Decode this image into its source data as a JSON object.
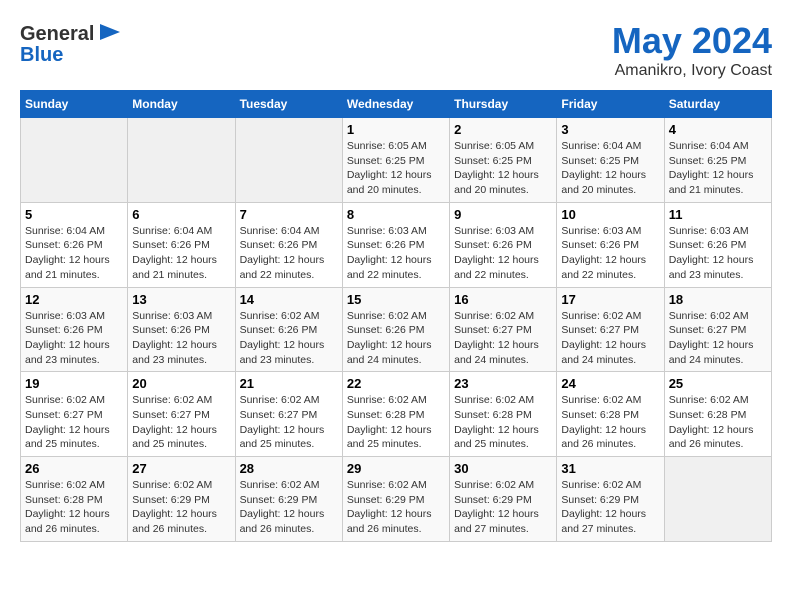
{
  "logo": {
    "general": "General",
    "blue": "Blue"
  },
  "title": "May 2024",
  "subtitle": "Amanikro, Ivory Coast",
  "days_header": [
    "Sunday",
    "Monday",
    "Tuesday",
    "Wednesday",
    "Thursday",
    "Friday",
    "Saturday"
  ],
  "weeks": [
    [
      {
        "day": "",
        "sunrise": "",
        "sunset": "",
        "daylight": ""
      },
      {
        "day": "",
        "sunrise": "",
        "sunset": "",
        "daylight": ""
      },
      {
        "day": "",
        "sunrise": "",
        "sunset": "",
        "daylight": ""
      },
      {
        "day": "1",
        "sunrise": "Sunrise: 6:05 AM",
        "sunset": "Sunset: 6:25 PM",
        "daylight": "Daylight: 12 hours and 20 minutes."
      },
      {
        "day": "2",
        "sunrise": "Sunrise: 6:05 AM",
        "sunset": "Sunset: 6:25 PM",
        "daylight": "Daylight: 12 hours and 20 minutes."
      },
      {
        "day": "3",
        "sunrise": "Sunrise: 6:04 AM",
        "sunset": "Sunset: 6:25 PM",
        "daylight": "Daylight: 12 hours and 20 minutes."
      },
      {
        "day": "4",
        "sunrise": "Sunrise: 6:04 AM",
        "sunset": "Sunset: 6:25 PM",
        "daylight": "Daylight: 12 hours and 21 minutes."
      }
    ],
    [
      {
        "day": "5",
        "sunrise": "Sunrise: 6:04 AM",
        "sunset": "Sunset: 6:26 PM",
        "daylight": "Daylight: 12 hours and 21 minutes."
      },
      {
        "day": "6",
        "sunrise": "Sunrise: 6:04 AM",
        "sunset": "Sunset: 6:26 PM",
        "daylight": "Daylight: 12 hours and 21 minutes."
      },
      {
        "day": "7",
        "sunrise": "Sunrise: 6:04 AM",
        "sunset": "Sunset: 6:26 PM",
        "daylight": "Daylight: 12 hours and 22 minutes."
      },
      {
        "day": "8",
        "sunrise": "Sunrise: 6:03 AM",
        "sunset": "Sunset: 6:26 PM",
        "daylight": "Daylight: 12 hours and 22 minutes."
      },
      {
        "day": "9",
        "sunrise": "Sunrise: 6:03 AM",
        "sunset": "Sunset: 6:26 PM",
        "daylight": "Daylight: 12 hours and 22 minutes."
      },
      {
        "day": "10",
        "sunrise": "Sunrise: 6:03 AM",
        "sunset": "Sunset: 6:26 PM",
        "daylight": "Daylight: 12 hours and 22 minutes."
      },
      {
        "day": "11",
        "sunrise": "Sunrise: 6:03 AM",
        "sunset": "Sunset: 6:26 PM",
        "daylight": "Daylight: 12 hours and 23 minutes."
      }
    ],
    [
      {
        "day": "12",
        "sunrise": "Sunrise: 6:03 AM",
        "sunset": "Sunset: 6:26 PM",
        "daylight": "Daylight: 12 hours and 23 minutes."
      },
      {
        "day": "13",
        "sunrise": "Sunrise: 6:03 AM",
        "sunset": "Sunset: 6:26 PM",
        "daylight": "Daylight: 12 hours and 23 minutes."
      },
      {
        "day": "14",
        "sunrise": "Sunrise: 6:02 AM",
        "sunset": "Sunset: 6:26 PM",
        "daylight": "Daylight: 12 hours and 23 minutes."
      },
      {
        "day": "15",
        "sunrise": "Sunrise: 6:02 AM",
        "sunset": "Sunset: 6:26 PM",
        "daylight": "Daylight: 12 hours and 24 minutes."
      },
      {
        "day": "16",
        "sunrise": "Sunrise: 6:02 AM",
        "sunset": "Sunset: 6:27 PM",
        "daylight": "Daylight: 12 hours and 24 minutes."
      },
      {
        "day": "17",
        "sunrise": "Sunrise: 6:02 AM",
        "sunset": "Sunset: 6:27 PM",
        "daylight": "Daylight: 12 hours and 24 minutes."
      },
      {
        "day": "18",
        "sunrise": "Sunrise: 6:02 AM",
        "sunset": "Sunset: 6:27 PM",
        "daylight": "Daylight: 12 hours and 24 minutes."
      }
    ],
    [
      {
        "day": "19",
        "sunrise": "Sunrise: 6:02 AM",
        "sunset": "Sunset: 6:27 PM",
        "daylight": "Daylight: 12 hours and 25 minutes."
      },
      {
        "day": "20",
        "sunrise": "Sunrise: 6:02 AM",
        "sunset": "Sunset: 6:27 PM",
        "daylight": "Daylight: 12 hours and 25 minutes."
      },
      {
        "day": "21",
        "sunrise": "Sunrise: 6:02 AM",
        "sunset": "Sunset: 6:27 PM",
        "daylight": "Daylight: 12 hours and 25 minutes."
      },
      {
        "day": "22",
        "sunrise": "Sunrise: 6:02 AM",
        "sunset": "Sunset: 6:28 PM",
        "daylight": "Daylight: 12 hours and 25 minutes."
      },
      {
        "day": "23",
        "sunrise": "Sunrise: 6:02 AM",
        "sunset": "Sunset: 6:28 PM",
        "daylight": "Daylight: 12 hours and 25 minutes."
      },
      {
        "day": "24",
        "sunrise": "Sunrise: 6:02 AM",
        "sunset": "Sunset: 6:28 PM",
        "daylight": "Daylight: 12 hours and 26 minutes."
      },
      {
        "day": "25",
        "sunrise": "Sunrise: 6:02 AM",
        "sunset": "Sunset: 6:28 PM",
        "daylight": "Daylight: 12 hours and 26 minutes."
      }
    ],
    [
      {
        "day": "26",
        "sunrise": "Sunrise: 6:02 AM",
        "sunset": "Sunset: 6:28 PM",
        "daylight": "Daylight: 12 hours and 26 minutes."
      },
      {
        "day": "27",
        "sunrise": "Sunrise: 6:02 AM",
        "sunset": "Sunset: 6:29 PM",
        "daylight": "Daylight: 12 hours and 26 minutes."
      },
      {
        "day": "28",
        "sunrise": "Sunrise: 6:02 AM",
        "sunset": "Sunset: 6:29 PM",
        "daylight": "Daylight: 12 hours and 26 minutes."
      },
      {
        "day": "29",
        "sunrise": "Sunrise: 6:02 AM",
        "sunset": "Sunset: 6:29 PM",
        "daylight": "Daylight: 12 hours and 26 minutes."
      },
      {
        "day": "30",
        "sunrise": "Sunrise: 6:02 AM",
        "sunset": "Sunset: 6:29 PM",
        "daylight": "Daylight: 12 hours and 27 minutes."
      },
      {
        "day": "31",
        "sunrise": "Sunrise: 6:02 AM",
        "sunset": "Sunset: 6:29 PM",
        "daylight": "Daylight: 12 hours and 27 minutes."
      },
      {
        "day": "",
        "sunrise": "",
        "sunset": "",
        "daylight": ""
      }
    ]
  ]
}
